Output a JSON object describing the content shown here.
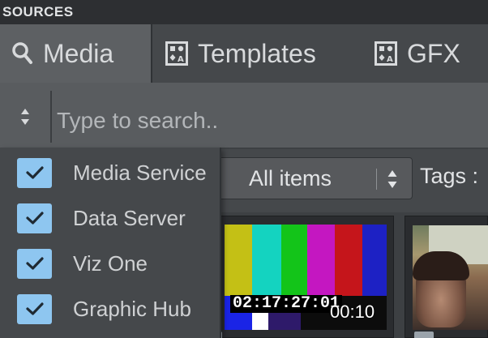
{
  "panel": {
    "title": "SOURCES"
  },
  "tabs": [
    {
      "label": "Media",
      "icon": "search-icon",
      "active": true
    },
    {
      "label": "Templates",
      "icon": "template-icon",
      "active": false
    },
    {
      "label": "GFX",
      "icon": "template-icon",
      "active": false
    }
  ],
  "search": {
    "placeholder": "Type to search..",
    "value": ""
  },
  "sources": [
    {
      "label": "Media Service",
      "checked": true
    },
    {
      "label": "Data Server",
      "checked": true
    },
    {
      "label": "Viz One",
      "checked": true
    },
    {
      "label": "Graphic Hub",
      "checked": true
    }
  ],
  "filter": {
    "selected": "All items",
    "tags_label": "Tags :"
  },
  "items": [
    {
      "timecode": "02:17:27:01",
      "duration": "00:10"
    }
  ],
  "colors": {
    "checkbox": "#8ec6f0",
    "active_tab": "#5d6063",
    "background": "#3e4144"
  }
}
